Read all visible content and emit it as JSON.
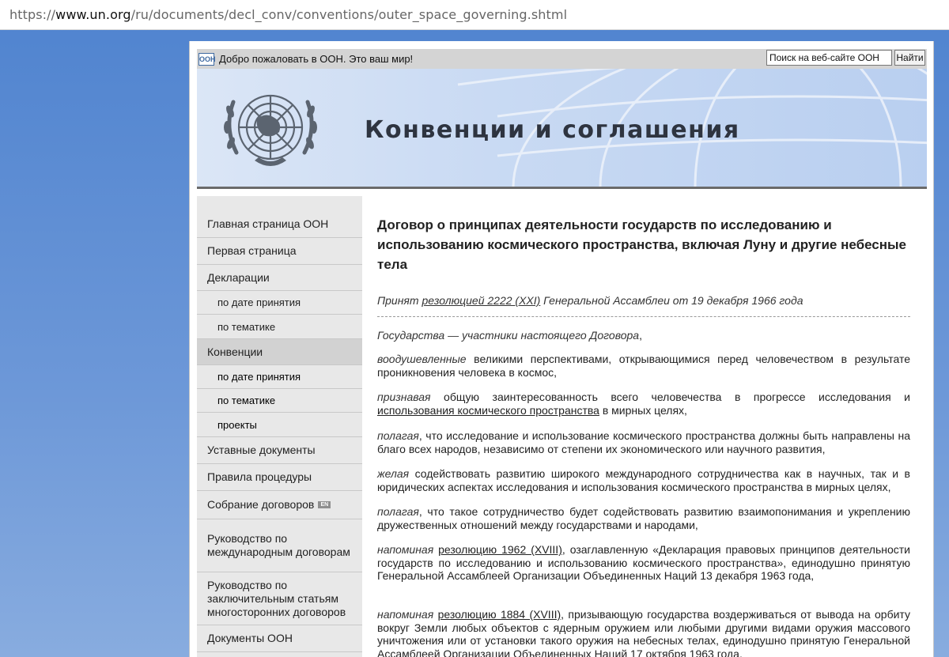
{
  "browser": {
    "url_scheme": "https://",
    "url_host": "www.un.org",
    "url_path": "/ru/documents/decl_conv/conventions/outer_space_governing.shtml"
  },
  "topbar": {
    "logo_text": "ООН",
    "welcome": "Добро пожаловать в ООН. Это ваш мир!",
    "search_value": "Поиск на веб-сайте ООН",
    "search_button": "Найти"
  },
  "banner": {
    "title": "Конвенции и соглашения"
  },
  "sidebar": {
    "items": [
      {
        "label": "Главная страница ООН"
      },
      {
        "label": "Первая страница"
      },
      {
        "label": "Декларации"
      },
      {
        "label": "по дате принятия"
      },
      {
        "label": "по тематике"
      },
      {
        "label": "Конвенции"
      },
      {
        "label": "по дате принятия"
      },
      {
        "label": "по тематике"
      },
      {
        "label": "проекты"
      },
      {
        "label": "Уставные документы"
      },
      {
        "label": "Правила процедуры"
      },
      {
        "label": "Собрание договоров",
        "badge": "EN"
      },
      {
        "label": "Руководство по международным договорам"
      },
      {
        "label": "Руководство по заключительным статьям многосторонних договоров"
      },
      {
        "label": "Документы ООН"
      }
    ]
  },
  "content": {
    "title": "Договор о принципах деятельности государств по исследованию и использованию космического пространства, включая Луну и другие небесные тела",
    "adopted_prefix": "Принят ",
    "adopted_link": "резолюцией 2222 (XXI)",
    "adopted_suffix": " Генеральной Ассамблеи от 19 декабря 1966 года",
    "paragraphs": [
      {
        "lead": "Государства — участники настоящего Договора",
        "text": ","
      },
      {
        "lead": "воодушевленные",
        "text": " великими перспективами, открывающимися перед человечеством в результате проникновения человека в космос,"
      },
      {
        "lead": "признавая",
        "text_before": " общую заинтересованность всего человечества в прогрессе исследования и ",
        "link": "использования космического пространства",
        "text_after": " в мирных целях,"
      },
      {
        "lead": "полагая",
        "text": ", что исследование и использование космического пространства должны быть направлены на благо всех народов, независимо от степени их экономического или научного развития,"
      },
      {
        "lead": "желая",
        "text": " содействовать развитию широкого международного сотрудничества как в научных, так и в юридических аспектах исследования и использования космического пространства в мирных целях,"
      },
      {
        "lead": "полагая",
        "text": ", что такое сотрудничество будет содействовать развитию взаимопонимания и укреплению дружественных отношений между государствами и народами,"
      },
      {
        "lead": "напоминая",
        "text_before": " ",
        "link": "резолюцию 1962 (XVIII)",
        "text_after": ", озаглавленную «Декларация правовых принципов деятельности государств по исследованию и использованию космического пространства», единодушно принятую Генеральной Ассамблеей Организации Объединенных Наций 13 декабря 1963 года,"
      },
      {
        "lead": "напоминая",
        "text_before": " ",
        "link": "резолюцию 1884 (XVIII)",
        "text_after": ", призывающую государства воздерживаться от вывода на орбиту вокруг Земли любых объектов с ядерным оружием или любыми другими видами оружия массового уничтожения или от установки такого оружия на небесных телах, единодушно принятую Генеральной Ассамблеей Организации Объединенных Наций 17 октября 1963 года,"
      }
    ]
  }
}
